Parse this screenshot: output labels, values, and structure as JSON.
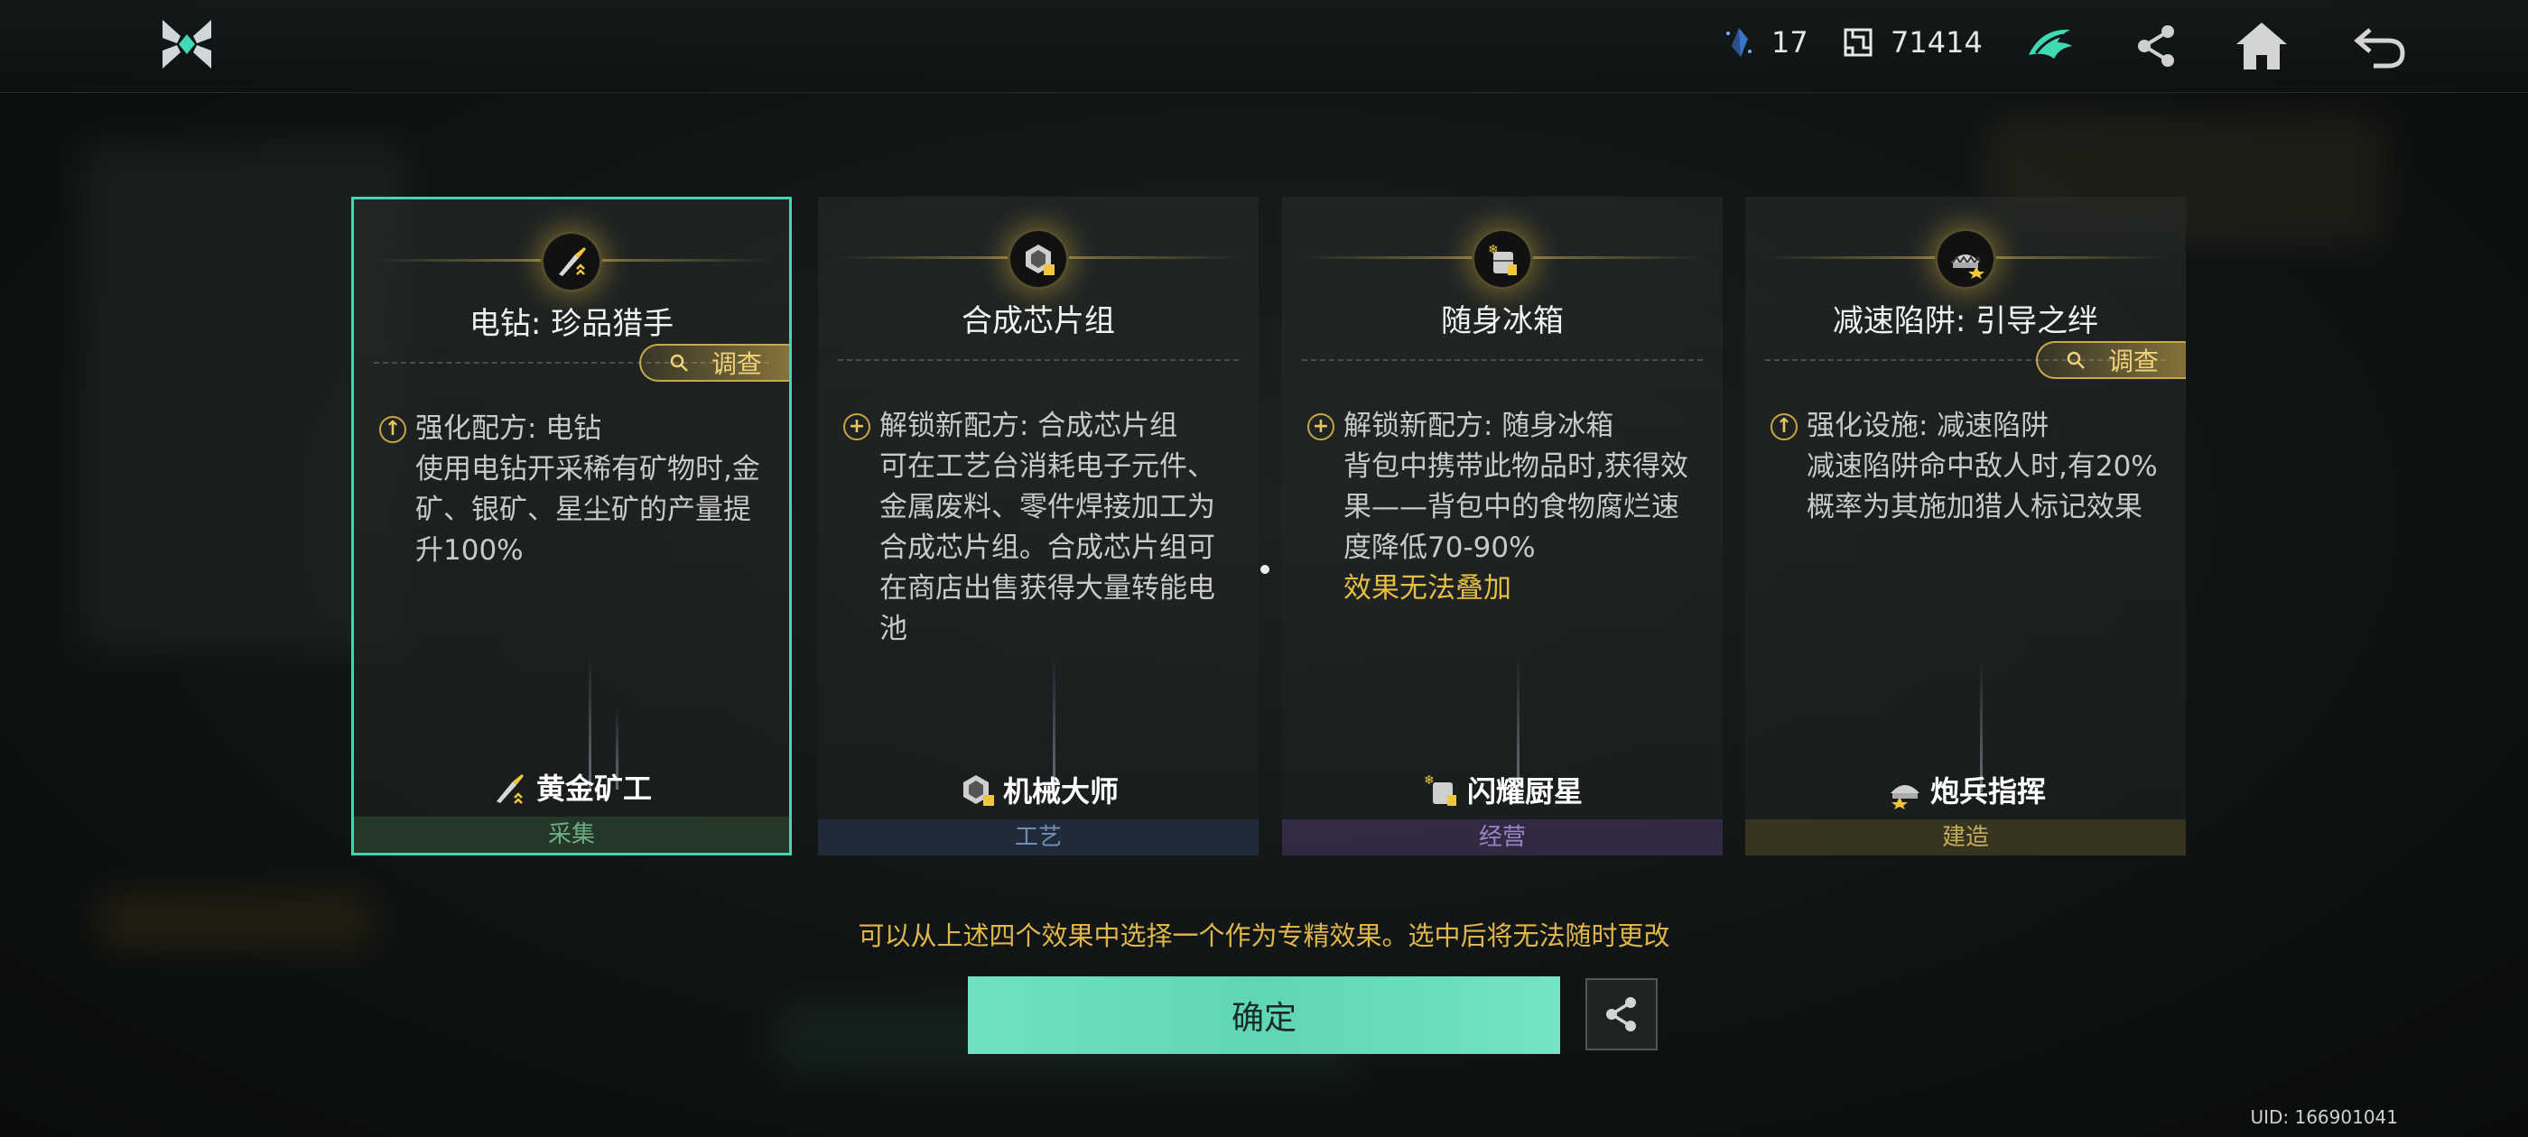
{
  "header": {
    "resource1": {
      "icon": "crystal-shard-icon",
      "value": "17"
    },
    "resource2": {
      "icon": "puzzle-currency-icon",
      "value": "71414"
    }
  },
  "cards": [
    {
      "title": "电钻: 珍品猎手",
      "investigate": "调查",
      "effect_title": "强化配方: 电钻",
      "effect_body": "使用电钻开采稀有矿物时,金矿、银矿、星尘矿的产量提升100%",
      "warning": "",
      "mastery": "黄金矿工",
      "category": "采集",
      "category_color": "#3f8a5a",
      "selected": true
    },
    {
      "title": "合成芯片组",
      "investigate": "",
      "effect_title": "解锁新配方: 合成芯片组",
      "effect_body": "可在工艺台消耗电子元件、金属废料、零件焊接加工为合成芯片组。合成芯片组可在商店出售获得大量转能电池",
      "warning": "",
      "mastery": "机械大师",
      "category": "工艺",
      "category_color": "#3f5f8a",
      "selected": false
    },
    {
      "title": "随身冰箱",
      "investigate": "",
      "effect_title": "解锁新配方: 随身冰箱",
      "effect_body": "背包中携带此物品时,获得效果——背包中的食物腐烂速度降低70-90%",
      "warning": "效果无法叠加",
      "mastery": "闪耀厨星",
      "category": "经营",
      "category_color": "#6a4f8e",
      "selected": false
    },
    {
      "title": "减速陷阱: 引导之绊",
      "investigate": "调查",
      "effect_title": "强化设施: 减速陷阱",
      "effect_body": "减速陷阱命中敌人时,有20%概率为其施加猎人标记效果",
      "warning": "",
      "mastery": "炮兵指挥",
      "category": "建造",
      "category_color": "#8a7a35",
      "selected": false
    }
  ],
  "hint": "可以从上述四个效果中选择一个作为专精效果。选中后将无法随时更改",
  "confirm_label": "确定",
  "uid": "UID: 166901041"
}
